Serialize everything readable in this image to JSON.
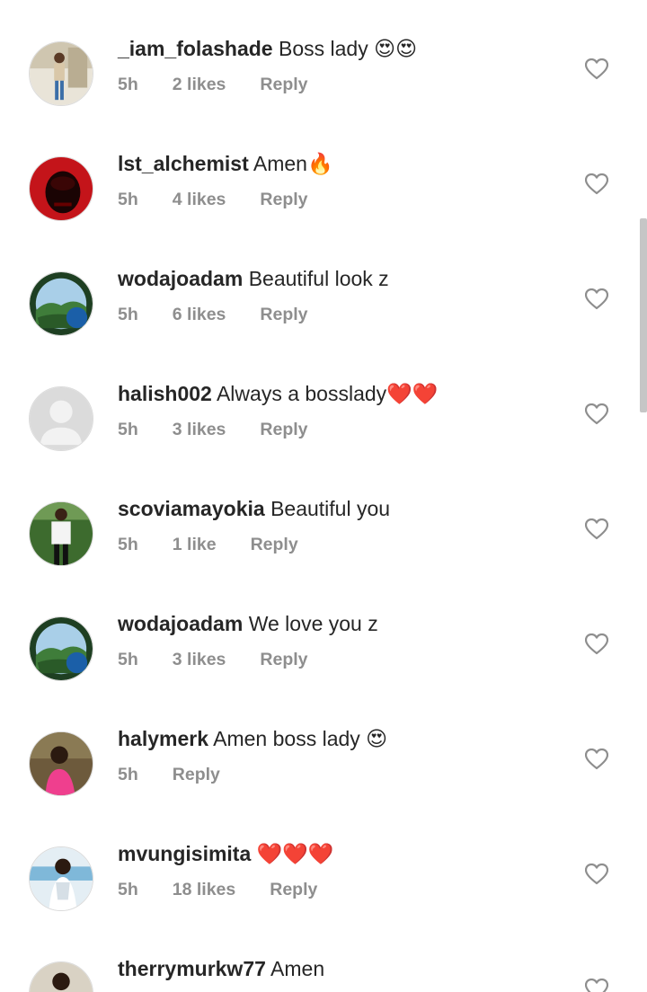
{
  "comments": [
    {
      "username": "_iam_folashade",
      "text": "Boss lady 😍😍",
      "time": "5h",
      "likes": "2 likes",
      "reply": "Reply"
    },
    {
      "username": "lst_alchemist",
      "text": "Amen🔥",
      "time": "5h",
      "likes": "4 likes",
      "reply": "Reply"
    },
    {
      "username": "wodajoadam",
      "text": "Beautiful look z",
      "time": "5h",
      "likes": "6 likes",
      "reply": "Reply"
    },
    {
      "username": "halish002",
      "text": "Always a bosslady❤️❤️",
      "time": "5h",
      "likes": "3 likes",
      "reply": "Reply"
    },
    {
      "username": "scoviamayokia",
      "text": "Beautiful you",
      "time": "5h",
      "likes": "1 like",
      "reply": "Reply"
    },
    {
      "username": "wodajoadam",
      "text": "We love you z",
      "time": "5h",
      "likes": "3 likes",
      "reply": "Reply"
    },
    {
      "username": "halymerk",
      "text": "Amen boss lady 😍",
      "time": "5h",
      "reply": "Reply"
    },
    {
      "username": "mvungisimita",
      "text": "❤️❤️❤️",
      "time": "5h",
      "likes": "18 likes",
      "reply": "Reply"
    },
    {
      "username": "therrymurkw77",
      "text": "Amen"
    }
  ],
  "icons": {
    "like": "heart-outline-icon",
    "default_avatar": "person-silhouette-icon"
  },
  "colors": {
    "text": "#262626",
    "secondary": "#8e8e8e",
    "heart_outline": "#8e8e8e",
    "scrollbar": "#c6c6c6"
  }
}
